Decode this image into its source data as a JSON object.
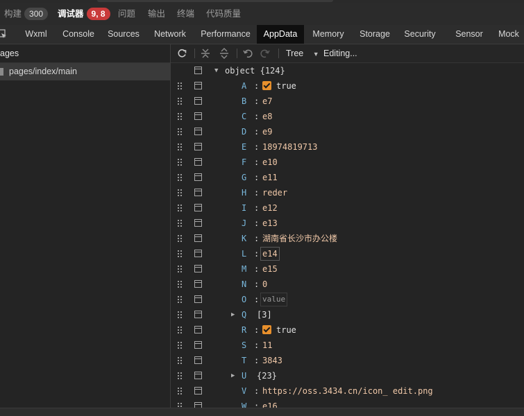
{
  "top_tabs": {
    "build": "构建",
    "build_count": "300",
    "debugger": "调试器",
    "debugger_count": "9, 8",
    "issues": "问题",
    "output": "输出",
    "terminal": "终端",
    "code_quality": "代码质量"
  },
  "panel_tabs": [
    "Wxml",
    "Console",
    "Sources",
    "Network",
    "Performance",
    "AppData",
    "Memory",
    "Storage",
    "Security",
    "Sensor",
    "Mock"
  ],
  "active_panel_tab": "AppData",
  "sidebar": {
    "title": "ages",
    "pages": [
      "pages/index/main"
    ]
  },
  "toolbar": {
    "view_mode": "Tree",
    "status": "Editing..."
  },
  "tree": {
    "root_key": "object",
    "root_count": "{124}",
    "rows": [
      {
        "key": "A",
        "type": "bool",
        "value": "true"
      },
      {
        "key": "B",
        "type": "text",
        "value": "e7"
      },
      {
        "key": "C",
        "type": "text",
        "value": "e8"
      },
      {
        "key": "D",
        "type": "text",
        "value": "e9"
      },
      {
        "key": "E",
        "type": "text",
        "value": "18974819713"
      },
      {
        "key": "F",
        "type": "text",
        "value": "e10"
      },
      {
        "key": "G",
        "type": "text",
        "value": "e11"
      },
      {
        "key": "H",
        "type": "text",
        "value": "reder"
      },
      {
        "key": "I",
        "type": "text",
        "value": "e12"
      },
      {
        "key": "J",
        "type": "text",
        "value": "e13"
      },
      {
        "key": "K",
        "type": "text",
        "value": "湖南省长沙市办公楼"
      },
      {
        "key": "L",
        "type": "edit",
        "value": "e14"
      },
      {
        "key": "M",
        "type": "text",
        "value": "e15"
      },
      {
        "key": "N",
        "type": "text",
        "value": "0"
      },
      {
        "key": "O",
        "type": "placeholder",
        "value": "value"
      },
      {
        "key": "Q",
        "type": "collapsed",
        "value": "[3]"
      },
      {
        "key": "R",
        "type": "bool",
        "value": "true"
      },
      {
        "key": "S",
        "type": "text",
        "value": "11"
      },
      {
        "key": "T",
        "type": "text",
        "value": "3843"
      },
      {
        "key": "U",
        "type": "collapsed",
        "value": "{23}"
      },
      {
        "key": "V",
        "type": "text",
        "value": "https://oss.3434.cn/icon_ edit.png"
      },
      {
        "key": "W",
        "type": "text",
        "value": "e16"
      }
    ]
  }
}
